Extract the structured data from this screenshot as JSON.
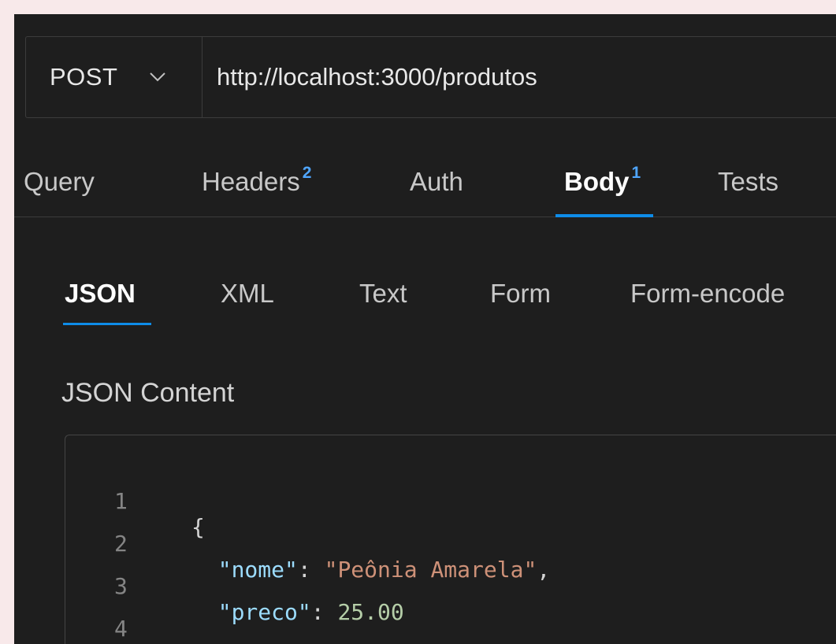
{
  "request": {
    "method": "POST",
    "url": "http://localhost:3000/produtos"
  },
  "tabs": [
    {
      "label": "Query",
      "badge": ""
    },
    {
      "label": "Headers",
      "badge": "2"
    },
    {
      "label": "Auth",
      "badge": ""
    },
    {
      "label": "Body",
      "badge": "1"
    },
    {
      "label": "Tests",
      "badge": ""
    }
  ],
  "body_tabs": [
    "JSON",
    "XML",
    "Text",
    "Form",
    "Form-encode"
  ],
  "section_label": "JSON Content",
  "editor": {
    "lines": [
      {
        "num": "1",
        "open": "{"
      },
      {
        "num": "2",
        "indent": "  ",
        "key": "\"nome\"",
        "colon": ": ",
        "value": "\"Peônia Amarela\"",
        "tail": ","
      },
      {
        "num": "3",
        "indent": "  ",
        "key": "\"preco\"",
        "colon": ": ",
        "value": "25.00",
        "tail": ""
      },
      {
        "num": "4",
        "close": "}"
      }
    ]
  },
  "colors": {
    "accent": "#0e8ce8",
    "badge": "#4fa6ff",
    "json_key": "#9cdcfe",
    "json_string": "#ce9178",
    "json_number": "#b5cea8"
  },
  "icons": {
    "method_dropdown": "chevron-down-icon"
  }
}
